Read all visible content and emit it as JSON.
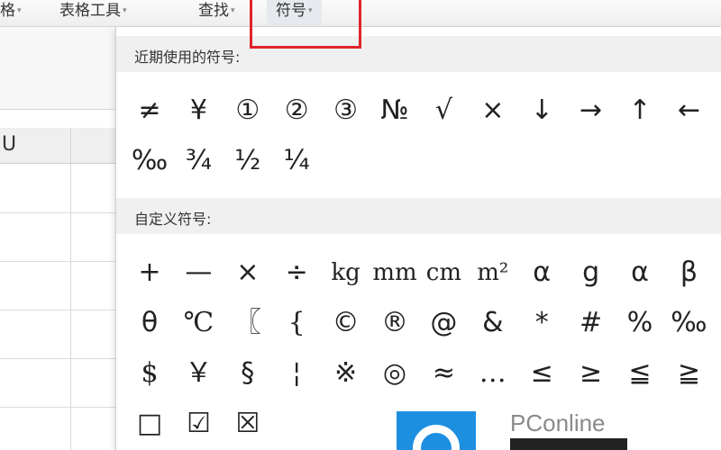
{
  "toolbar": {
    "items": [
      {
        "label": "格",
        "caret": "▾"
      },
      {
        "label": "表格工具",
        "caret": "▾"
      },
      {
        "label": "查找",
        "caret": "▾"
      },
      {
        "label": "符号",
        "caret": "▾"
      }
    ]
  },
  "sheet": {
    "column_header": "U"
  },
  "panel": {
    "recent_title": "近期使用的符号:",
    "recent_symbols": [
      "≠",
      "¥",
      "①",
      "②",
      "③",
      "№",
      "√",
      "×",
      "↓",
      "→",
      "↑",
      "←",
      "‰",
      "¾",
      "½",
      "¼"
    ],
    "custom_title": "自定义符号:",
    "custom_symbols": [
      "+",
      "—",
      "×",
      "÷",
      "kg",
      "mm",
      "cm",
      "m²",
      "α",
      "g",
      "α",
      "β",
      "θ",
      "℃",
      "〖",
      "{",
      "©",
      "®",
      "@",
      "&",
      "*",
      "#",
      "%",
      "‰",
      "$",
      "￥",
      "§",
      "¦",
      "※",
      "◎",
      "≈",
      "…",
      "≤",
      "≥",
      "≦",
      "≧",
      "□",
      "☑",
      "☒"
    ]
  },
  "watermark": {
    "text": "PConline"
  },
  "colors": {
    "highlight_box": "#e0242b",
    "watermark_blue": "#1d8fe0"
  }
}
